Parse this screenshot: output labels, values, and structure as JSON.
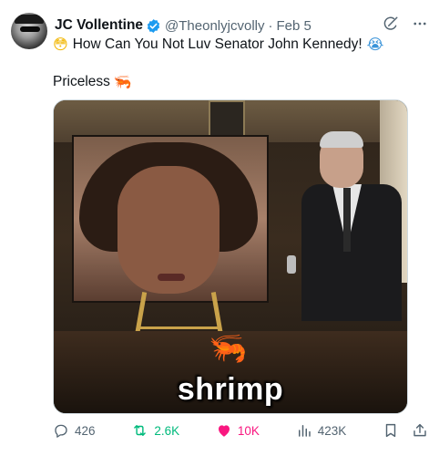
{
  "tweet": {
    "author": {
      "name": "JC Vollentine",
      "handle": "@Theonlyjcvolly",
      "separator": "·",
      "date": "Feb 5",
      "verified": true
    },
    "text_lead_emoji": "😳",
    "text": "How Can You Not Luv Senator John Kennedy!",
    "text_trail_emoji": "😭",
    "second_line": "Priceless",
    "second_line_emoji": "🦐",
    "media": {
      "caption_emoji": "🦐",
      "caption_text": "shrimp"
    },
    "stats": {
      "replies": "426",
      "reposts": "2.6K",
      "likes": "10K",
      "views": "423K"
    }
  },
  "colors": {
    "accent_blue": "#1d9bf0",
    "like_pink": "#f91880",
    "repost_green": "#00ba7c",
    "muted_text": "#536471"
  },
  "icons": {
    "verified": "verified-badge-icon",
    "grok": "grok-icon",
    "more": "more-icon",
    "reply": "reply-icon",
    "repost": "repost-icon",
    "like": "heart-icon",
    "views": "views-chart-icon",
    "bookmark": "bookmark-icon",
    "share": "share-icon"
  }
}
